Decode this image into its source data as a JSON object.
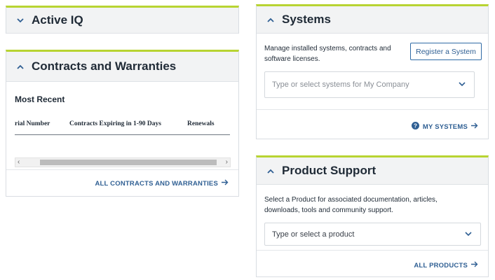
{
  "active_iq": {
    "title": "Active IQ",
    "expanded": false
  },
  "contracts": {
    "title": "Contracts and Warranties",
    "subheading": "Most Recent",
    "columns": [
      "rial Number",
      "Contracts Expiring in 1-90 Days",
      "Renewals"
    ],
    "link_label": "ALL CONTRACTS AND WARRANTIES"
  },
  "systems": {
    "title": "Systems",
    "description": "Manage installed systems, contracts and software licenses.",
    "register_button": "Register a System",
    "select_placeholder": "Type or select systems for My Company",
    "link_label": "MY SYSTEMS"
  },
  "product_support": {
    "title": "Product Support",
    "description": "Select a Product for associated documentation, articles, downloads, tools and community support.",
    "select_placeholder": "Type or select a product",
    "link_label": "ALL PRODUCTS"
  },
  "colors": {
    "accent": "#b8d432",
    "link": "#2f5f93",
    "header_bg": "#f2f3f4"
  }
}
